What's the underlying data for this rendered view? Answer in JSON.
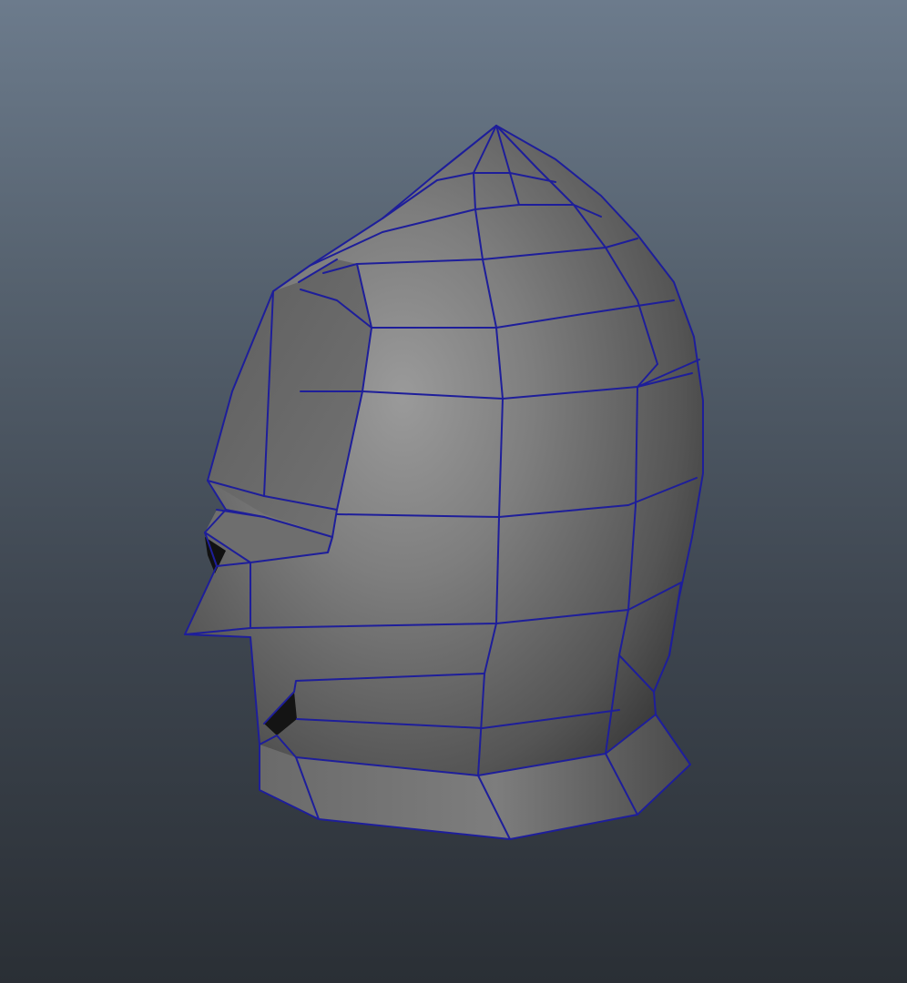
{
  "viewport": {
    "background_top": "#6c7b8c",
    "background_bottom": "#2a2f35"
  },
  "model": {
    "shading": "smooth-shaded-with-wireframe",
    "surface_color": "#7a7a7a",
    "wireframe_color": "#1e1e9a"
  }
}
